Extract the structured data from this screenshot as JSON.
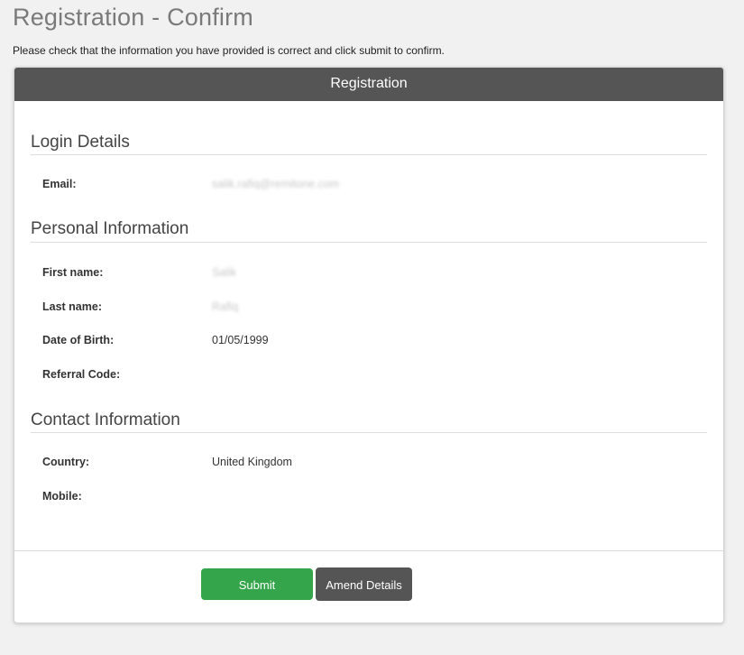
{
  "page": {
    "title": "Registration - Confirm",
    "intro": "Please check that the information you have provided is correct and click submit to confirm."
  },
  "panel": {
    "header": "Registration"
  },
  "sections": {
    "login": {
      "title": "Login Details",
      "email_label": "Email:",
      "email_value": "salik.rafiq@remitone.com"
    },
    "personal": {
      "title": "Personal Information",
      "first_name_label": "First name:",
      "first_name_value": "Salik",
      "last_name_label": "Last name:",
      "last_name_value": "Rafiq",
      "dob_label": "Date of Birth:",
      "dob_value": "01/05/1999",
      "referral_label": "Referral Code:",
      "referral_value": ""
    },
    "contact": {
      "title": "Contact Information",
      "country_label": "Country:",
      "country_value": "United Kingdom",
      "mobile_label": "Mobile:",
      "mobile_value": ""
    }
  },
  "actions": {
    "submit_label": "Submit",
    "amend_label": "Amend Details"
  },
  "colors": {
    "header_bg": "#555555",
    "submit_bg": "#34a54a",
    "amend_bg": "#555555"
  }
}
